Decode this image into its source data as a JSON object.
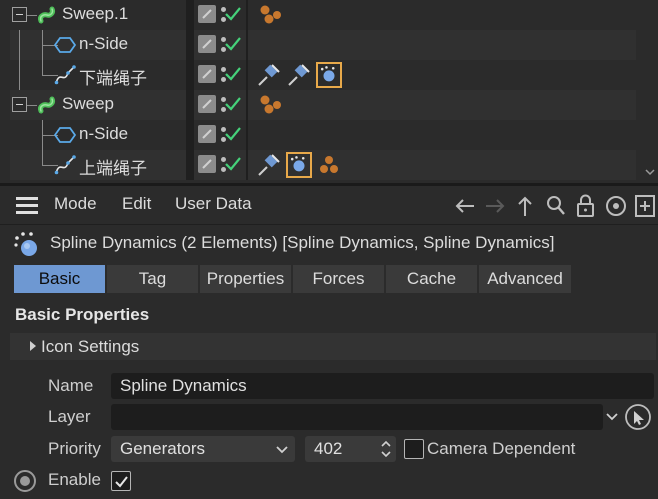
{
  "object_manager": {
    "rows": [
      {
        "name": "Sweep.1",
        "type": "sweep"
      },
      {
        "name": "n-Side",
        "type": "nside"
      },
      {
        "name": "下端绳子",
        "type": "spline"
      },
      {
        "name": "Sweep",
        "type": "sweep"
      },
      {
        "name": "n-Side",
        "type": "nside"
      },
      {
        "name": "上端绳子",
        "type": "spline"
      }
    ]
  },
  "menubar": {
    "items": [
      "Mode",
      "Edit",
      "User Data"
    ],
    "toolbar_icons": [
      "back-arrow-icon",
      "forward-arrow-icon",
      "up-arrow-icon",
      "search-icon",
      "lock-icon",
      "target-icon",
      "new-panel-icon"
    ]
  },
  "header": {
    "title": "Spline Dynamics (2 Elements) [Spline Dynamics, Spline Dynamics]"
  },
  "tabs": [
    "Basic",
    "Tag",
    "Properties",
    "Forces",
    "Cache",
    "Advanced"
  ],
  "active_tab": "Basic",
  "basic": {
    "section_title": "Basic Properties",
    "group_label": "Icon Settings",
    "name_label": "Name",
    "name_value": "Spline Dynamics",
    "layer_label": "Layer",
    "layer_value": "",
    "priority_label": "Priority",
    "priority_value": "Generators",
    "priority_number": "402",
    "camera_dependent_label": "Camera Dependent",
    "camera_dependent_checked": false,
    "enable_label": "Enable",
    "enable_checked": true
  },
  "colors": {
    "active_tab": "#6e98d2",
    "check_green": "#45d17a",
    "tag_orange": "#e8a94a",
    "sphere_orange": "#c8782e"
  }
}
